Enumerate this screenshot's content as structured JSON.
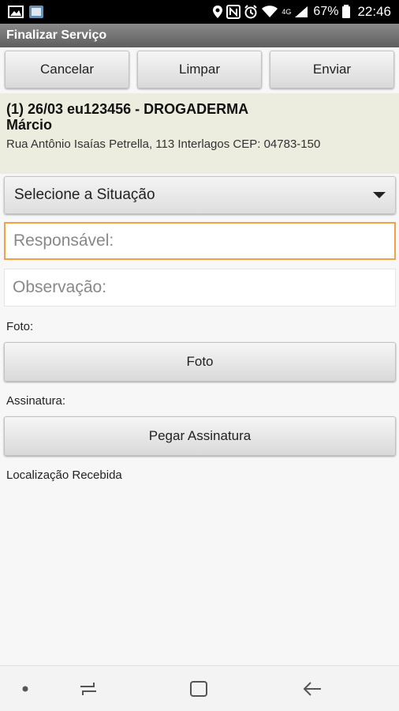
{
  "status_bar": {
    "battery": "67%",
    "time": "22:46",
    "signal_label": "4G"
  },
  "app": {
    "title": "Finalizar Serviço"
  },
  "toolbar": {
    "cancel_label": "Cancelar",
    "clear_label": "Limpar",
    "send_label": "Enviar"
  },
  "order": {
    "line1": "(1) 26/03 eu123456 - DROGADERMA",
    "line2": "Márcio",
    "address": "Rua Antônio Isaías Petrella, 113 Interlagos CEP: 04783-150"
  },
  "form": {
    "situation_placeholder": "Selecione a Situação",
    "responsible_placeholder": "Responsável:",
    "observation_placeholder": "Observação:",
    "photo_label": "Foto:",
    "photo_button": "Foto",
    "signature_label": "Assinatura:",
    "signature_button": "Pegar Assinatura",
    "location_status": "Localização Recebida"
  },
  "colors": {
    "accent_focus": "#f5a142",
    "header_bg": "#ececdf",
    "title_bar": "#6e6e6e"
  }
}
